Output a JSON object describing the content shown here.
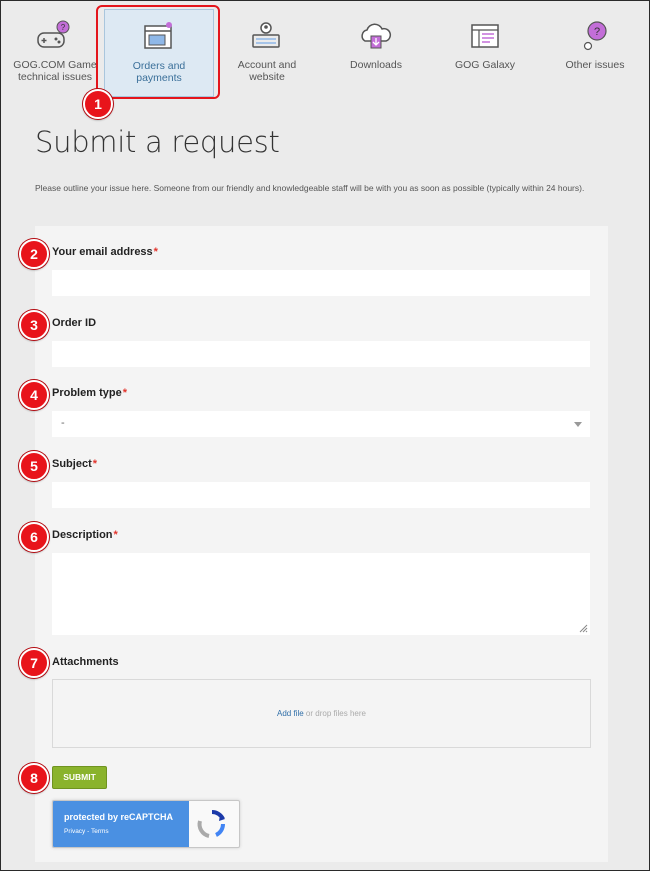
{
  "categories": [
    {
      "line1": "GOG.COM Game",
      "line2": "technical issues",
      "icon": "gamepad-question-icon"
    },
    {
      "line1": "Orders and",
      "line2": "payments",
      "icon": "cart-payment-icon"
    },
    {
      "line1": "Account and",
      "line2": "website",
      "icon": "account-keyboard-icon"
    },
    {
      "line1": "Downloads",
      "line2": "",
      "icon": "cloud-download-icon"
    },
    {
      "line1": "GOG Galaxy",
      "line2": "",
      "icon": "galaxy-window-icon"
    },
    {
      "line1": "Other issues",
      "line2": "",
      "icon": "question-bubble-icon"
    }
  ],
  "markers": [
    "1",
    "2",
    "3",
    "4",
    "5",
    "6",
    "7",
    "8"
  ],
  "page": {
    "title": "Submit a request",
    "intro": "Please outline your issue here. Someone from our friendly and knowledgeable staff will be with you as soon as possible (typically within 24 hours)."
  },
  "form": {
    "email_label": "Your email address",
    "order_label": "Order ID",
    "problem_label": "Problem type",
    "problem_value": "-",
    "subject_label": "Subject",
    "description_label": "Description",
    "attachments_label": "Attachments",
    "add_file": "Add file",
    "drop_text": " or drop files here",
    "required_mark": "*",
    "submit": "SUBMIT"
  },
  "captcha": {
    "text": "protected by reCAPTCHA",
    "links": "Privacy - Terms"
  },
  "colors": {
    "marker": "#e8141b",
    "submit": "#8ab32c",
    "link": "#2f6ea8",
    "captcha": "#4a90e2"
  }
}
